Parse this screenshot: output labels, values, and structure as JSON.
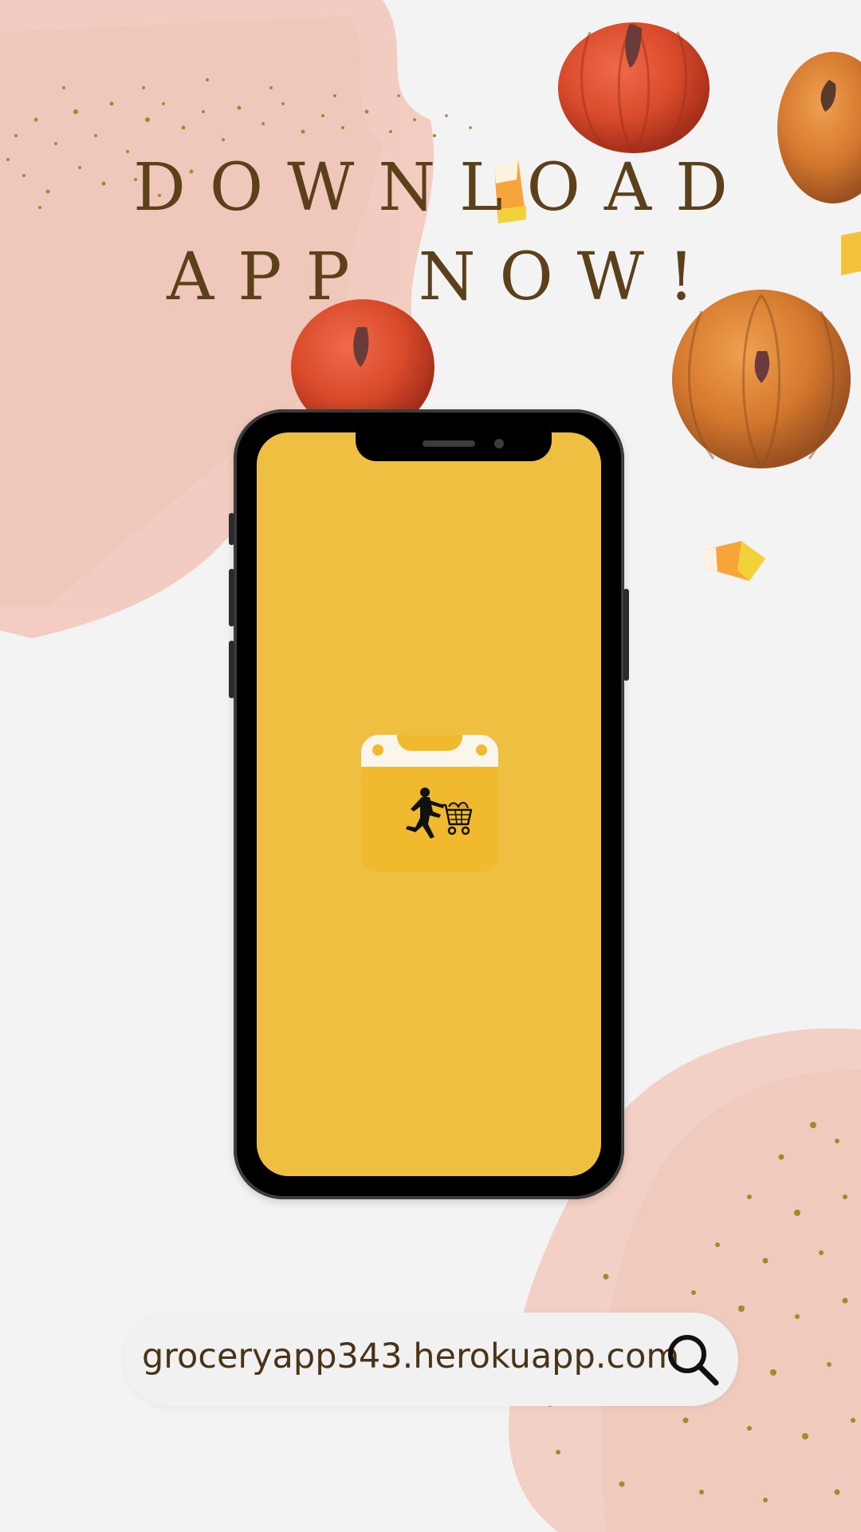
{
  "headline": {
    "line1": "DOWNLOAD",
    "line2": "APP NOW!"
  },
  "search": {
    "url": "groceryapp343.herokuapp.com",
    "icon": "search-icon"
  },
  "phone": {
    "screen_color": "#eebf40",
    "app_icon": "shopping-cart-runner-icon"
  },
  "colors": {
    "headline": "#5b4019",
    "brush_pink": "#f2c8bd",
    "glitter": "#a48a2c",
    "pumpkin": "#d2502c"
  }
}
